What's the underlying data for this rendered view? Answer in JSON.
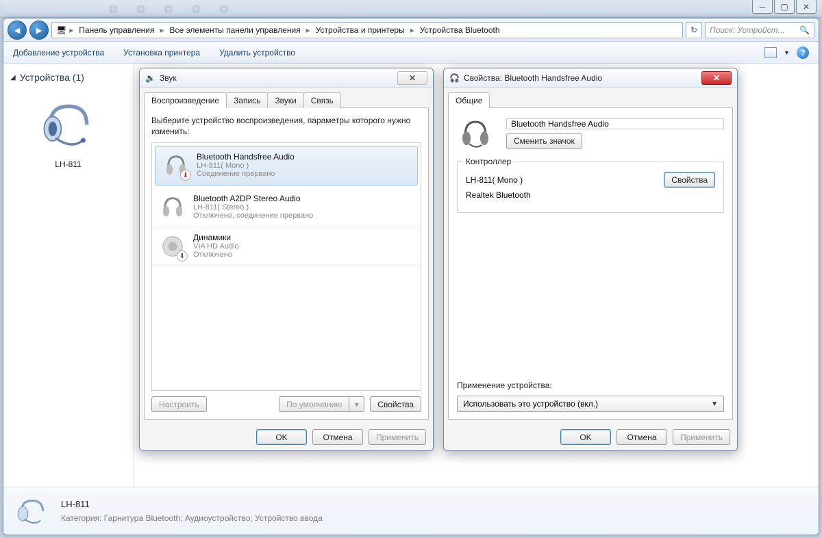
{
  "breadcrumb": {
    "items": [
      "Панель управления",
      "Все элементы панели управления",
      "Устройства и принтеры",
      "Устройства Bluetooth"
    ]
  },
  "search": {
    "placeholder": "Поиск: Устройст..."
  },
  "toolbar": {
    "add_device": "Добавление устройства",
    "add_printer": "Установка принтера",
    "remove_device": "Удалить устройство"
  },
  "sidebar": {
    "section_title": "Устройства (1)",
    "device_label": "LH-811"
  },
  "sound_dialog": {
    "title": "Звук",
    "tabs": [
      "Воспроизведение",
      "Запись",
      "Звуки",
      "Связь"
    ],
    "hint": "Выберите устройство воспроизведения, параметры которого нужно изменить:",
    "devices": [
      {
        "name": "Bluetooth Handsfree Audio",
        "sub": "LH-811( Mono )",
        "status": "Соединение прервано",
        "badge": "↓",
        "badge_color": "#c62828"
      },
      {
        "name": "Bluetooth A2DP Stereo Audio",
        "sub": "LH-811( Stereo )",
        "status": "Отключено, соединение прервано",
        "badge": "",
        "badge_color": ""
      },
      {
        "name": "Динамики",
        "sub": "VIA HD Audio",
        "status": "Отключено",
        "badge": "↓",
        "badge_color": "#555"
      }
    ],
    "btn_configure": "Настроить",
    "btn_default": "По умолчанию",
    "btn_properties": "Свойства",
    "btn_ok": "OK",
    "btn_cancel": "Отмена",
    "btn_apply": "Применить"
  },
  "props_dialog": {
    "title": "Свойства: Bluetooth Handsfree Audio",
    "tab_general": "Общие",
    "device_name": "Bluetooth Handsfree Audio",
    "btn_change_icon": "Сменить значок",
    "controller_legend": "Контроллер",
    "controller_line1": "LH-811( Mono )",
    "controller_line2": "Realtek Bluetooth",
    "btn_properties": "Свойства",
    "usage_label": "Применение устройства:",
    "usage_value": "Использовать это устройство (вкл.)",
    "btn_ok": "OK",
    "btn_cancel": "Отмена",
    "btn_apply": "Применить"
  },
  "details": {
    "name": "LH-811",
    "category_key": "Категория:",
    "category_val": "Гарнитура Bluetooth; Аудиоустройство; Устройство ввода"
  }
}
